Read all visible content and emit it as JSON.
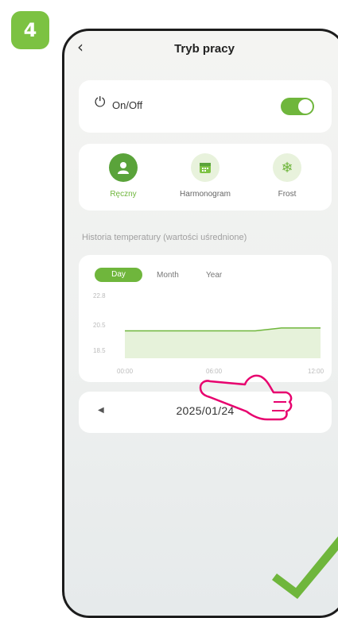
{
  "step": {
    "number": "4"
  },
  "header": {
    "title": "Tryb pracy",
    "back_icon": "chevron-left-icon"
  },
  "power": {
    "label": "On/Off",
    "icon": "power-icon",
    "state": "on",
    "accent": "#6fb63c"
  },
  "modes": [
    {
      "label": "Ręczny",
      "icon": "person-icon",
      "active": true
    },
    {
      "label": "Harmonogram",
      "icon": "calendar-icon",
      "active": false
    },
    {
      "label": "Frost",
      "icon": "snowflake-icon",
      "active": false
    }
  ],
  "history": {
    "section_label": "Historia temperatury (wartości uśrednione)",
    "tabs": [
      "Day",
      "Month",
      "Year"
    ],
    "active_tab": "Day"
  },
  "chart_data": {
    "type": "area",
    "x": [
      "00:00",
      "06:00",
      "12:00"
    ],
    "ylim": [
      18.5,
      22.8
    ],
    "y_ticks": [
      "22.8",
      "20.5",
      "18.5"
    ],
    "x_ticks": [
      "00:00",
      "06:00",
      "12:00"
    ],
    "series": [
      {
        "points": [
          [
            0,
            20.4
          ],
          [
            8,
            20.4
          ],
          [
            9.6,
            20.6
          ],
          [
            12,
            20.6
          ]
        ]
      }
    ],
    "color": "#6fb63c"
  },
  "date_nav": {
    "date": "2025/01/24",
    "prev_icon": "triangle-left-icon"
  }
}
